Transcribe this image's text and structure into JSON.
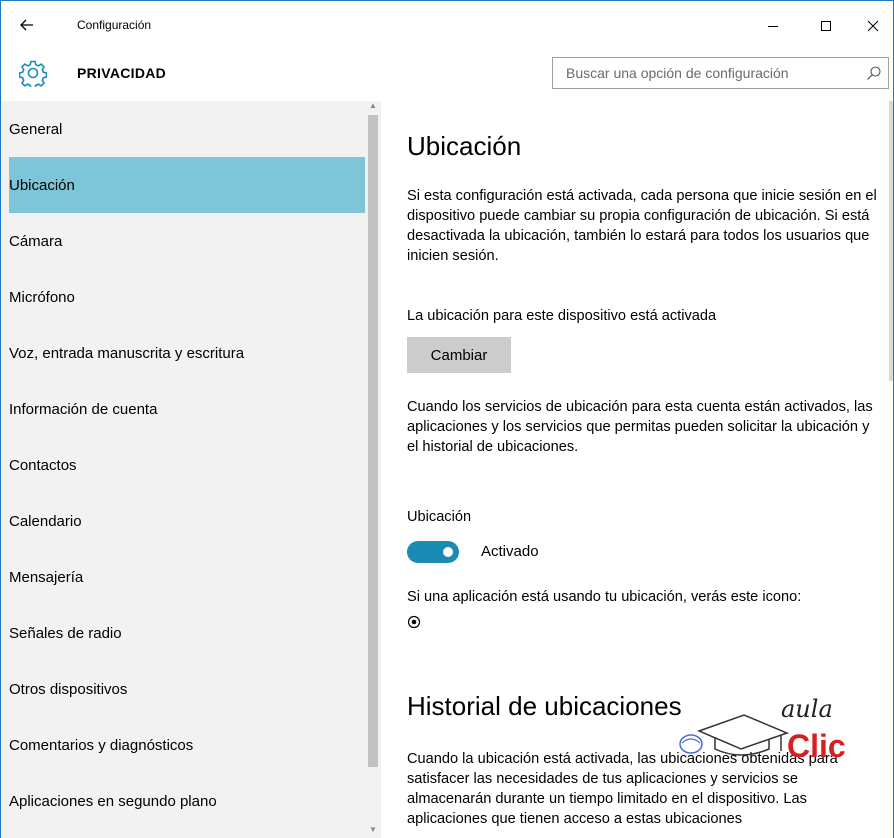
{
  "window": {
    "title": "Configuración",
    "controls": {
      "minimize": "minimize",
      "maximize": "maximize",
      "close": "close"
    }
  },
  "header": {
    "section_title": "PRIVACIDAD",
    "search": {
      "placeholder": "Buscar una opción de configuración",
      "value": ""
    }
  },
  "sidebar": {
    "active_index": 1,
    "items": [
      {
        "label": "General"
      },
      {
        "label": "Ubicación"
      },
      {
        "label": "Cámara"
      },
      {
        "label": "Micrófono"
      },
      {
        "label": "Voz, entrada manuscrita y escritura"
      },
      {
        "label": "Información de cuenta"
      },
      {
        "label": "Contactos"
      },
      {
        "label": "Calendario"
      },
      {
        "label": "Mensajería"
      },
      {
        "label": "Señales de radio"
      },
      {
        "label": "Otros dispositivos"
      },
      {
        "label": "Comentarios y diagnósticos"
      },
      {
        "label": "Aplicaciones en segundo plano"
      }
    ]
  },
  "main": {
    "heading": "Ubicación",
    "description": "Si esta configuración está activada, cada persona que inicie sesión en el dispositivo puede cambiar su propia configuración de ubicación. Si está desactivada la ubicación, también lo estará para todos los usuarios que inicien sesión.",
    "device_status": "La ubicación para este dispositivo está activada",
    "change_button": "Cambiar",
    "account_description": "Cuando los servicios de ubicación para esta cuenta están activados, las aplicaciones y los servicios que permitas pueden solicitar la ubicación y el historial de ubicaciones.",
    "toggle_label": "Ubicación",
    "toggle_state": "Activado",
    "toggle_on": true,
    "icon_note": "Si una aplicación está usando tu ubicación, verás este icono:",
    "history_heading": "Historial de ubicaciones",
    "history_description": "Cuando la ubicación está activada, las ubicaciones obtenidas para satisfacer las necesidades de tus aplicaciones y servicios se almacenarán durante un tiempo limitado en el dispositivo. Las aplicaciones que tienen acceso a estas ubicaciones"
  },
  "watermark": {
    "text_top": "aula",
    "text_bottom": "Clic"
  },
  "colors": {
    "accent": "#1a8bb3",
    "selected_nav": "#7fc5d8",
    "sidebar_bg": "#f2f2f2",
    "button_bg": "#cccccc",
    "window_border": "#1e78c8",
    "logo_red": "#d6201f"
  },
  "icons": {
    "back": "back-arrow-icon",
    "settings": "gear-icon",
    "search": "search-icon",
    "location": "location-indicator-icon"
  }
}
